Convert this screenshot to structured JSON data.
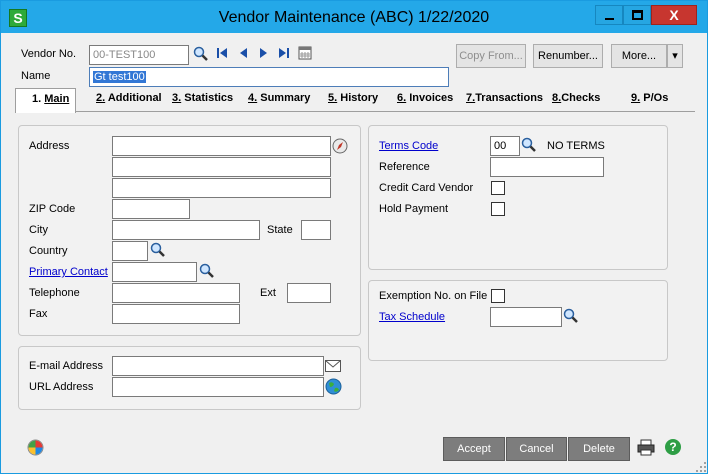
{
  "window": {
    "app_icon_letter": "S",
    "title": "Vendor Maintenance (ABC) 1/22/2020",
    "close_glyph": "X"
  },
  "header": {
    "vendor_no_label": "Vendor No.",
    "vendor_no_value": "00-TEST100",
    "name_label": "Name",
    "name_value": "Gt test100",
    "copy_from_label": "Copy From...",
    "renumber_label": "Renumber...",
    "more_label": "More...",
    "more_arrow": "▾"
  },
  "tabs": [
    {
      "num": "1.",
      "label": "Main"
    },
    {
      "num": "2.",
      "label": "Additional"
    },
    {
      "num": "3.",
      "label": "Statistics"
    },
    {
      "num": "4.",
      "label": "Summary"
    },
    {
      "num": "5.",
      "label": "History"
    },
    {
      "num": "6.",
      "label": "Invoices"
    },
    {
      "num": "7.",
      "label": "Transactions"
    },
    {
      "num": "8.",
      "label": "Checks"
    },
    {
      "num": "9.",
      "label": "P/Os"
    }
  ],
  "address_panel": {
    "address_label": "Address",
    "zip_label": "ZIP Code",
    "city_label": "City",
    "state_label": "State",
    "country_label": "Country",
    "primary_contact_label": "Primary Contact",
    "telephone_label": "Telephone",
    "ext_label": "Ext",
    "fax_label": "Fax"
  },
  "email_panel": {
    "email_label": "E-mail Address",
    "url_label": "URL Address"
  },
  "terms_panel": {
    "terms_code_label": "Terms Code",
    "terms_code_value": "00",
    "terms_desc": "NO TERMS",
    "reference_label": "Reference",
    "credit_card_label": "Credit Card Vendor",
    "hold_payment_label": "Hold Payment"
  },
  "tax_panel": {
    "exemption_label": "Exemption No. on File",
    "tax_schedule_label": "Tax Schedule"
  },
  "footer": {
    "accept_label": "Accept",
    "cancel_label": "Cancel",
    "delete_label": "Delete",
    "help_glyph": "?"
  },
  "colors": {
    "titlebar": "#24a8e8",
    "close": "#c7362f",
    "link": "#0000cc",
    "selection": "#3277d5"
  }
}
